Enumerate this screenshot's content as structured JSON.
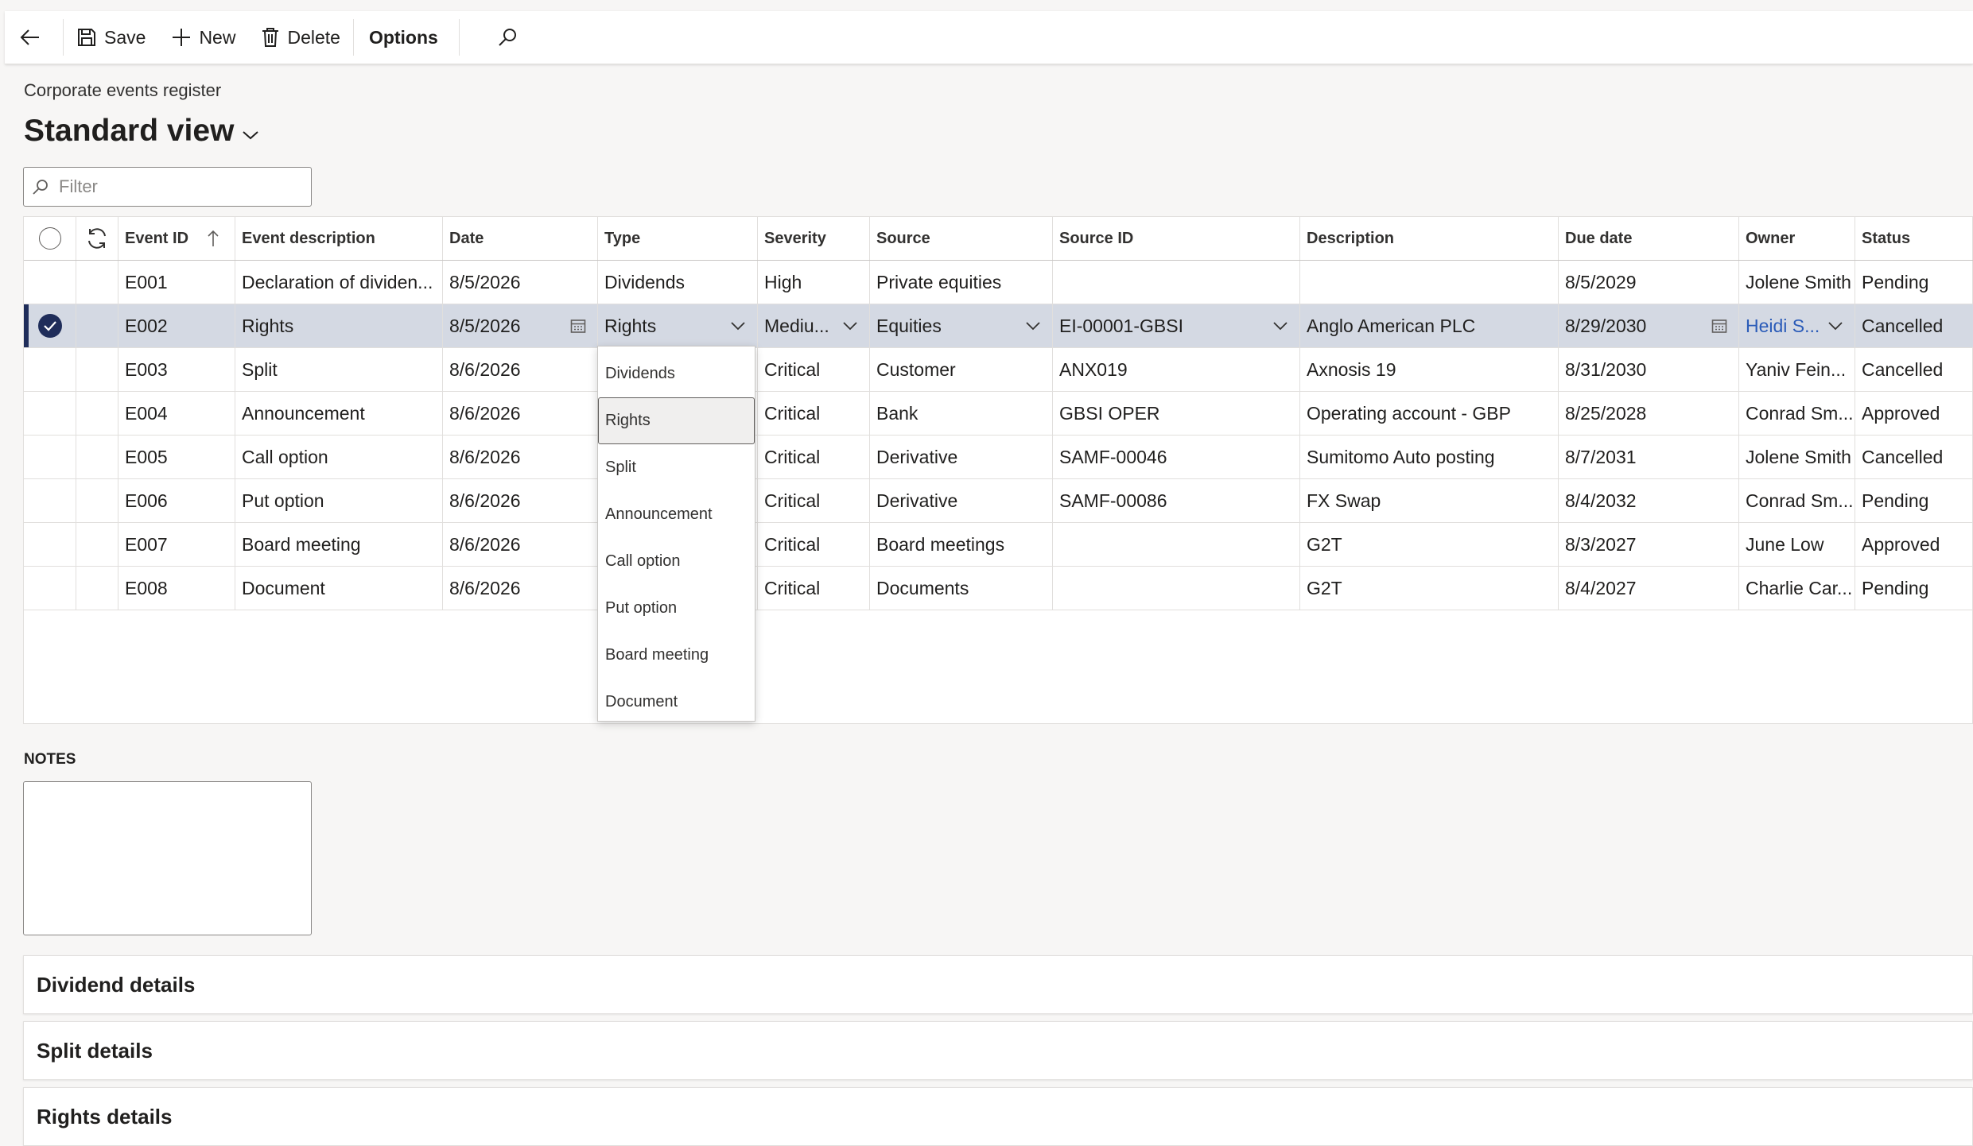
{
  "toolbar": {
    "save_label": "Save",
    "new_label": "New",
    "delete_label": "Delete",
    "options_label": "Options"
  },
  "page": {
    "caption": "Corporate events register",
    "view_title": "Standard view"
  },
  "filter": {
    "placeholder": "Filter"
  },
  "grid": {
    "columns": {
      "event_id": "Event ID",
      "event_description": "Event description",
      "date": "Date",
      "type": "Type",
      "severity": "Severity",
      "source": "Source",
      "source_id": "Source ID",
      "description": "Description",
      "due_date": "Due date",
      "owner": "Owner",
      "status": "Status"
    },
    "rows": [
      {
        "event_id": "E001",
        "event_description": "Declaration of dividen...",
        "date": "8/5/2026",
        "type": "Dividends",
        "severity": "High",
        "source": "Private equities",
        "source_id": "",
        "description": "",
        "due_date": "8/5/2029",
        "owner": "Jolene Smith",
        "status": "Pending"
      },
      {
        "event_id": "E002",
        "event_description": "Rights",
        "date": "8/5/2026",
        "type": "Rights",
        "severity": "Mediu...",
        "source": "Equities",
        "source_id": "EI-00001-GBSI",
        "description": "Anglo American PLC",
        "due_date": "8/29/2030",
        "owner": "Heidi S...",
        "status": "Cancelled"
      },
      {
        "event_id": "E003",
        "event_description": "Split",
        "date": "8/6/2026",
        "type": "",
        "severity": "Critical",
        "source": "Customer",
        "source_id": "ANX019",
        "description": "Axnosis 19",
        "due_date": "8/31/2030",
        "owner": "Yaniv Fein...",
        "status": "Cancelled"
      },
      {
        "event_id": "E004",
        "event_description": "Announcement",
        "date": "8/6/2026",
        "type": "",
        "severity": "Critical",
        "source": "Bank",
        "source_id": "GBSI OPER",
        "description": "Operating account - GBP",
        "due_date": "8/25/2028",
        "owner": "Conrad Sm...",
        "status": "Approved"
      },
      {
        "event_id": "E005",
        "event_description": "Call option",
        "date": "8/6/2026",
        "type": "",
        "severity": "Critical",
        "source": "Derivative",
        "source_id": "SAMF-00046",
        "description": "Sumitomo Auto posting",
        "due_date": "8/7/2031",
        "owner": "Jolene Smith",
        "status": "Cancelled"
      },
      {
        "event_id": "E006",
        "event_description": "Put option",
        "date": "8/6/2026",
        "type": "",
        "severity": "Critical",
        "source": "Derivative",
        "source_id": "SAMF-00086",
        "description": "FX Swap",
        "due_date": "8/4/2032",
        "owner": "Conrad Sm...",
        "status": "Pending"
      },
      {
        "event_id": "E007",
        "event_description": "Board meeting",
        "date": "8/6/2026",
        "type": "",
        "severity": "Critical",
        "source": "Board meetings",
        "source_id": "",
        "description": "G2T",
        "due_date": "8/3/2027",
        "owner": "June Low",
        "status": "Approved"
      },
      {
        "event_id": "E008",
        "event_description": "Document",
        "date": "8/6/2026",
        "type": "",
        "severity": "Critical",
        "source": "Documents",
        "source_id": "",
        "description": "G2T",
        "due_date": "8/4/2027",
        "owner": "Charlie Car...",
        "status": "Pending"
      }
    ]
  },
  "type_dropdown": {
    "options": [
      "Dividends",
      "Rights",
      "Split",
      "Announcement",
      "Call option",
      "Put option",
      "Board meeting",
      "Document"
    ],
    "selected": "Rights"
  },
  "notes": {
    "label": "NOTES"
  },
  "fasttabs": {
    "dividend": "Dividend details",
    "split": "Split details",
    "rights": "Rights details"
  },
  "colors": {
    "accent": "#1f2d5a",
    "selected_row": "#d4d9e3",
    "link": "#2a5bb8"
  },
  "icons": {
    "back": "back-arrow-icon",
    "save": "save-icon",
    "new": "plus-icon",
    "delete": "trash-icon",
    "search": "search-icon",
    "refresh": "refresh-icon",
    "sort": "sort-ascending-icon",
    "calendar": "calendar-icon",
    "chevron": "chevron-down-icon"
  }
}
